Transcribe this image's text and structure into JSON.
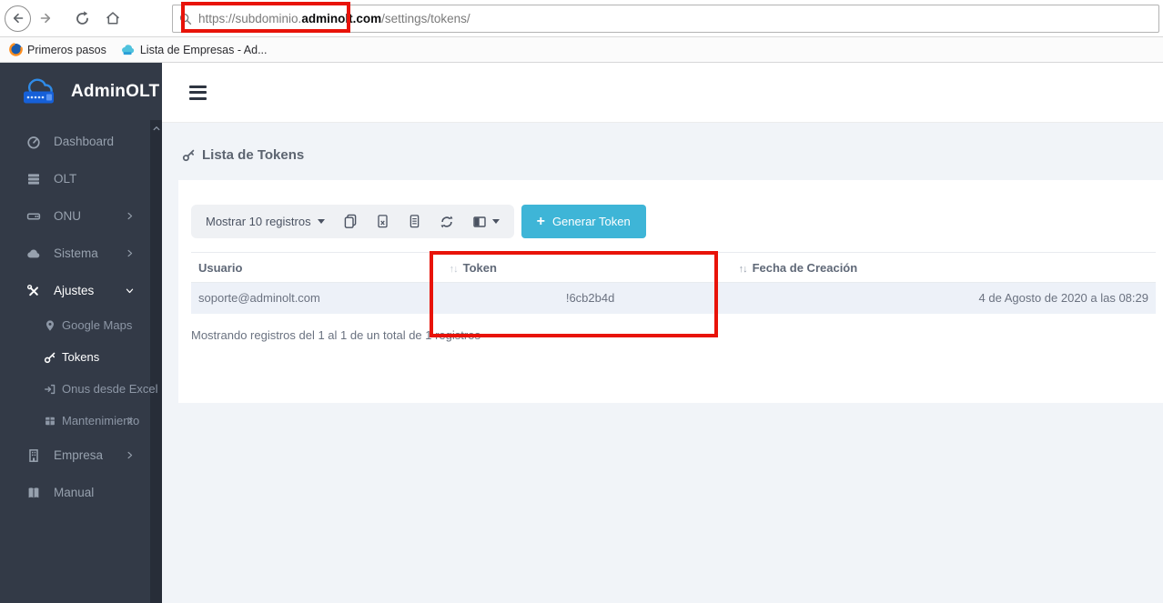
{
  "browser": {
    "url": {
      "prefix": "https://subdominio.",
      "domain": "adminolt.com",
      "path": "/settings/tokens/"
    },
    "bookmarks": {
      "b1": "Primeros pasos",
      "b2": "Lista de Empresas - Ad..."
    }
  },
  "sidebar": {
    "brand": "AdminOLT",
    "items": {
      "dashboard": "Dashboard",
      "olt": "OLT",
      "onu": "ONU",
      "sistema": "Sistema",
      "ajustes": "Ajustes",
      "empresa": "Empresa",
      "manual": "Manual"
    },
    "subitems": {
      "google_maps": "Google Maps",
      "tokens": "Tokens",
      "onus_excel": "Onus desde Excel",
      "mantenimiento": "Mantenimiento"
    }
  },
  "page": {
    "title": "Lista de Tokens"
  },
  "toolbar": {
    "show_entries": "Mostrar 10 registros",
    "plus": "+",
    "generate": "Generar Token"
  },
  "table": {
    "headers": {
      "user": "Usuario",
      "token": "Token",
      "date": "Fecha de Creación",
      "sort": "↑↓"
    },
    "row": {
      "user": "soporte@adminolt.com",
      "token": "!6cb2b4d",
      "date": "4 de Agosto de 2020 a las 08:29"
    },
    "footer": "Mostrando registros del 1 al 1 de un total de 1 registros"
  },
  "colors": {
    "accent": "#3eb5d7",
    "highlight_red": "#e81309",
    "sidebar_bg": "#333a47",
    "row_stripe": "#edf1f8"
  }
}
